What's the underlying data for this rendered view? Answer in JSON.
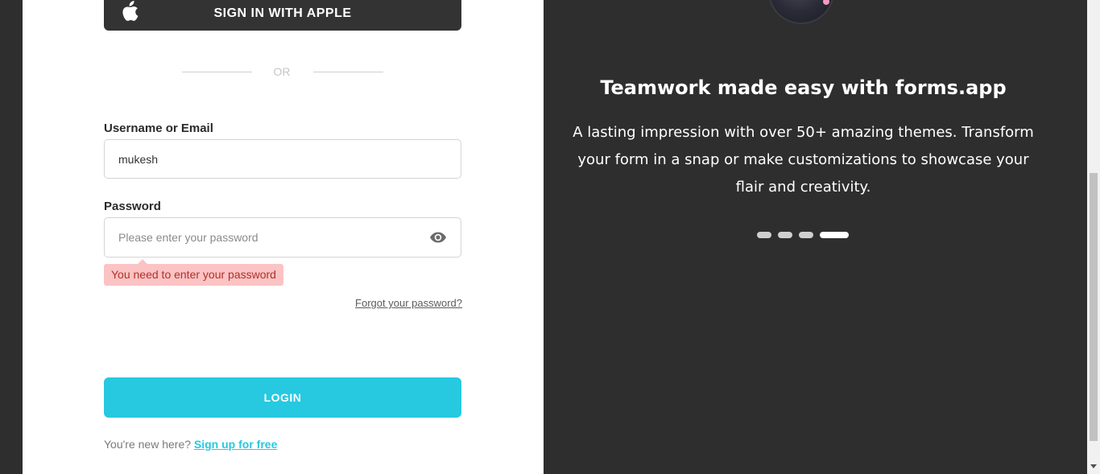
{
  "login": {
    "apple_label": "SIGN IN WITH APPLE",
    "or_text": "OR",
    "username_label": "Username or Email",
    "username_value": "mukesh",
    "password_label": "Password",
    "password_placeholder": "Please enter your password",
    "password_error": "You need to enter your password",
    "forgot_label": "Forgot your password?",
    "login_label": "LOGIN",
    "signup_prompt": "You're new here?",
    "signup_link": "Sign up for free"
  },
  "promo": {
    "title": "Teamwork made easy with forms.app",
    "description": "A lasting impression with over 50+ amazing themes. Transform your form in a snap or make customizations to showcase your flair and creativity.",
    "slides_count": 4,
    "active_slide": 4
  },
  "colors": {
    "accent": "#26c9e0",
    "dark_bg": "#2e2e2e",
    "apple_button": "#333333",
    "error_bg": "#fbc3c3",
    "error_text": "#b0302b"
  },
  "icons": {
    "apple": "apple-icon",
    "eye": "eye-icon"
  }
}
